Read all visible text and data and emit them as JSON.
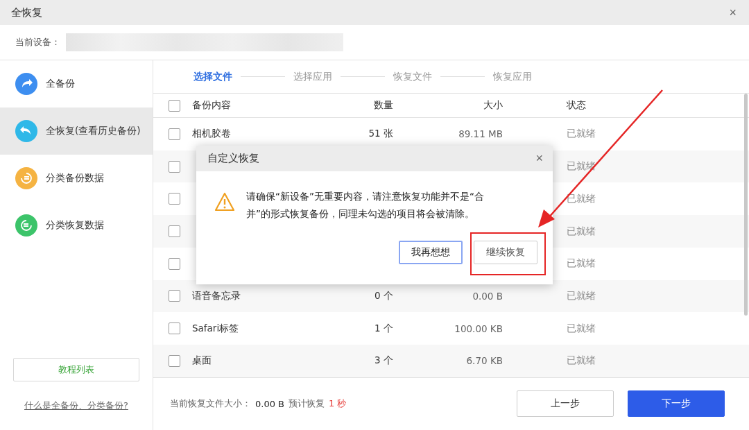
{
  "window": {
    "title": "全恢复",
    "close": "×"
  },
  "device": {
    "label": "当前设备："
  },
  "sidebar": {
    "items": [
      {
        "label": "全备份",
        "kind": "backup",
        "color": "#3d8ef0",
        "selected": false
      },
      {
        "label": "全恢复(查看历史备份)",
        "kind": "restore",
        "color": "#2fb8e8",
        "selected": true
      },
      {
        "label": "分类备份数据",
        "kind": "category-backup",
        "color": "#f5b342",
        "selected": false
      },
      {
        "label": "分类恢复数据",
        "kind": "category-restore",
        "color": "#3cc46a",
        "selected": false
      }
    ],
    "tutorial_button": "教程列表",
    "help_link": "什么是全备份、分类备份?"
  },
  "steps": [
    {
      "label": "选择文件",
      "selected": true
    },
    {
      "label": "选择应用",
      "selected": false
    },
    {
      "label": "恢复文件",
      "selected": false
    },
    {
      "label": "恢复应用",
      "selected": false
    }
  ],
  "table": {
    "columns": [
      "备份内容",
      "数量",
      "大小",
      "状态"
    ],
    "all_checked": false,
    "rows": [
      {
        "name": "相机胶卷",
        "count": "51 张",
        "size": "89.11 MB",
        "status": "已就绪",
        "checked": false
      },
      {
        "status": "已就绪",
        "checked": false
      },
      {
        "status": "已就绪",
        "checked": false
      },
      {
        "status": "已就绪",
        "checked": false
      },
      {
        "status": "已就绪",
        "checked": false
      },
      {
        "name": "语音备忘录",
        "count": "0 个",
        "size": "0.00 B",
        "status": "已就绪",
        "checked": false
      },
      {
        "name": "Safari标签",
        "count": "1 个",
        "size": "100.00 KB",
        "status": "已就绪",
        "checked": false
      },
      {
        "name": "桌面",
        "count": "3 个",
        "size": "6.70 KB",
        "status": "已就绪",
        "checked": false
      }
    ]
  },
  "footer": {
    "size_label": "当前恢复文件大小：",
    "size_value": "0.00 B",
    "eta_label": "预计恢复",
    "eta_value": "1 秒",
    "prev_button": "上一步",
    "next_button": "下一步"
  },
  "dialog": {
    "title": "自定义恢复",
    "close": "×",
    "message": "请确保“新设备”无重要内容，请注意恢复功能并不是“合并”的形式恢复备份，同理未勾选的项目将会被清除。",
    "cancel_button": "我再想想",
    "confirm_button": "继续恢复"
  }
}
